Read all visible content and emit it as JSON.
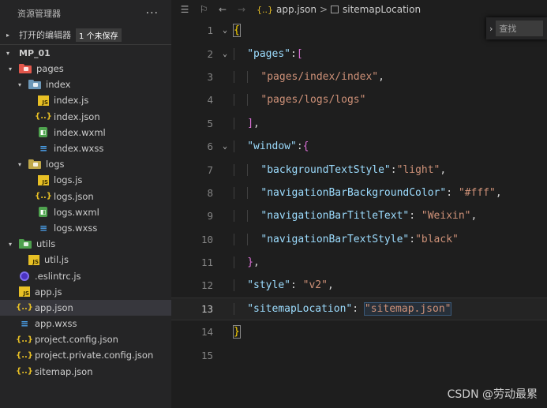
{
  "explorer": {
    "title": "资源管理器",
    "more": "···",
    "open_editors_label": "打开的编辑器",
    "unsaved_badge": "1 个未保存",
    "project_label": "MP_01"
  },
  "tree": [
    {
      "label": "pages",
      "kind": "folder-red",
      "depth": 1,
      "arrow": "▾"
    },
    {
      "label": "index",
      "kind": "folder-blue",
      "depth": 2,
      "arrow": "▾"
    },
    {
      "label": "index.js",
      "kind": "js",
      "depth": 3,
      "arrow": ""
    },
    {
      "label": "index.json",
      "kind": "json",
      "depth": 3,
      "arrow": ""
    },
    {
      "label": "index.wxml",
      "kind": "wxml",
      "depth": 3,
      "arrow": ""
    },
    {
      "label": "index.wxss",
      "kind": "wxss",
      "depth": 3,
      "arrow": ""
    },
    {
      "label": "logs",
      "kind": "folder-olive",
      "depth": 2,
      "arrow": "▾"
    },
    {
      "label": "logs.js",
      "kind": "js",
      "depth": 3,
      "arrow": ""
    },
    {
      "label": "logs.json",
      "kind": "json",
      "depth": 3,
      "arrow": ""
    },
    {
      "label": "logs.wxml",
      "kind": "wxml",
      "depth": 3,
      "arrow": ""
    },
    {
      "label": "logs.wxss",
      "kind": "wxss",
      "depth": 3,
      "arrow": ""
    },
    {
      "label": "utils",
      "kind": "folder-green",
      "depth": 1,
      "arrow": "▾"
    },
    {
      "label": "util.js",
      "kind": "js",
      "depth": 2,
      "arrow": ""
    },
    {
      "label": ".eslintrc.js",
      "kind": "eslint",
      "depth": 1,
      "arrow": ""
    },
    {
      "label": "app.js",
      "kind": "js",
      "depth": 1,
      "arrow": ""
    },
    {
      "label": "app.json",
      "kind": "json",
      "depth": 1,
      "arrow": "",
      "active": true
    },
    {
      "label": "app.wxss",
      "kind": "wxss",
      "depth": 1,
      "arrow": ""
    },
    {
      "label": "project.config.json",
      "kind": "json",
      "depth": 1,
      "arrow": ""
    },
    {
      "label": "project.private.config.json",
      "kind": "json",
      "depth": 1,
      "arrow": ""
    },
    {
      "label": "sitemap.json",
      "kind": "json",
      "depth": 1,
      "arrow": ""
    }
  ],
  "breadcrumb": {
    "file_icon": "{..}",
    "file": "app.json",
    "separator": ">",
    "symbol": "sitemapLocation"
  },
  "find": {
    "placeholder": "查找"
  },
  "code_lines": [
    {
      "n": "1",
      "fold": "⌄",
      "indent": 0,
      "tokens": [
        {
          "t": "{",
          "c": "t-br1 bracket-box"
        }
      ]
    },
    {
      "n": "2",
      "fold": "⌄",
      "indent": 1,
      "tokens": [
        {
          "t": "\"pages\"",
          "c": "t-key"
        },
        {
          "t": ":",
          "c": "t-punc"
        },
        {
          "t": "[",
          "c": "t-br2"
        }
      ]
    },
    {
      "n": "3",
      "fold": "",
      "indent": 2,
      "tokens": [
        {
          "t": "\"pages/index/index\"",
          "c": "t-str"
        },
        {
          "t": ",",
          "c": "t-punc"
        }
      ]
    },
    {
      "n": "4",
      "fold": "",
      "indent": 2,
      "tokens": [
        {
          "t": "\"pages/logs/logs\"",
          "c": "t-str"
        }
      ]
    },
    {
      "n": "5",
      "fold": "",
      "indent": 1,
      "tokens": [
        {
          "t": "]",
          "c": "t-br2"
        },
        {
          "t": ",",
          "c": "t-punc"
        }
      ]
    },
    {
      "n": "6",
      "fold": "⌄",
      "indent": 1,
      "tokens": [
        {
          "t": "\"window\"",
          "c": "t-key"
        },
        {
          "t": ":",
          "c": "t-punc"
        },
        {
          "t": "{",
          "c": "t-br2"
        }
      ]
    },
    {
      "n": "7",
      "fold": "",
      "indent": 2,
      "tokens": [
        {
          "t": "\"backgroundTextStyle\"",
          "c": "t-key"
        },
        {
          "t": ":",
          "c": "t-punc"
        },
        {
          "t": "\"light\"",
          "c": "t-str"
        },
        {
          "t": ",",
          "c": "t-punc"
        }
      ]
    },
    {
      "n": "8",
      "fold": "",
      "indent": 2,
      "tokens": [
        {
          "t": "\"navigationBarBackgroundColor\"",
          "c": "t-key"
        },
        {
          "t": ": ",
          "c": "t-punc"
        },
        {
          "t": "\"#fff\"",
          "c": "t-str"
        },
        {
          "t": ",",
          "c": "t-punc"
        }
      ]
    },
    {
      "n": "9",
      "fold": "",
      "indent": 2,
      "tokens": [
        {
          "t": "\"navigationBarTitleText\"",
          "c": "t-key"
        },
        {
          "t": ": ",
          "c": "t-punc"
        },
        {
          "t": "\"Weixin\"",
          "c": "t-str"
        },
        {
          "t": ",",
          "c": "t-punc"
        }
      ]
    },
    {
      "n": "10",
      "fold": "",
      "indent": 2,
      "tokens": [
        {
          "t": "\"navigationBarTextStyle\"",
          "c": "t-key"
        },
        {
          "t": ":",
          "c": "t-punc"
        },
        {
          "t": "\"black\"",
          "c": "t-str"
        }
      ]
    },
    {
      "n": "11",
      "fold": "",
      "indent": 1,
      "tokens": [
        {
          "t": "}",
          "c": "t-br2"
        },
        {
          "t": ",",
          "c": "t-punc"
        }
      ]
    },
    {
      "n": "12",
      "fold": "",
      "indent": 1,
      "tokens": [
        {
          "t": "\"style\"",
          "c": "t-key"
        },
        {
          "t": ": ",
          "c": "t-punc"
        },
        {
          "t": "\"v2\"",
          "c": "t-str"
        },
        {
          "t": ",",
          "c": "t-punc"
        }
      ]
    },
    {
      "n": "13",
      "fold": "",
      "indent": 1,
      "current": true,
      "tokens": [
        {
          "t": "\"sitemapLocation\"",
          "c": "t-key"
        },
        {
          "t": ": ",
          "c": "t-punc"
        },
        {
          "t": "\"sitemap.json\"",
          "c": "t-str selhl"
        }
      ]
    },
    {
      "n": "14",
      "fold": "",
      "indent": 0,
      "tokens": [
        {
          "t": "}",
          "c": "t-br1 bracket-box"
        }
      ]
    },
    {
      "n": "15",
      "fold": "",
      "indent": 0,
      "tokens": []
    }
  ],
  "watermark": "CSDN @劳动最累",
  "colors": {
    "accent_yellow": "#e8c025",
    "key_blue": "#9cdcfe",
    "string_orange": "#ce9178",
    "bracket_gold": "#ffd700",
    "bracket_purple": "#da70d6"
  }
}
